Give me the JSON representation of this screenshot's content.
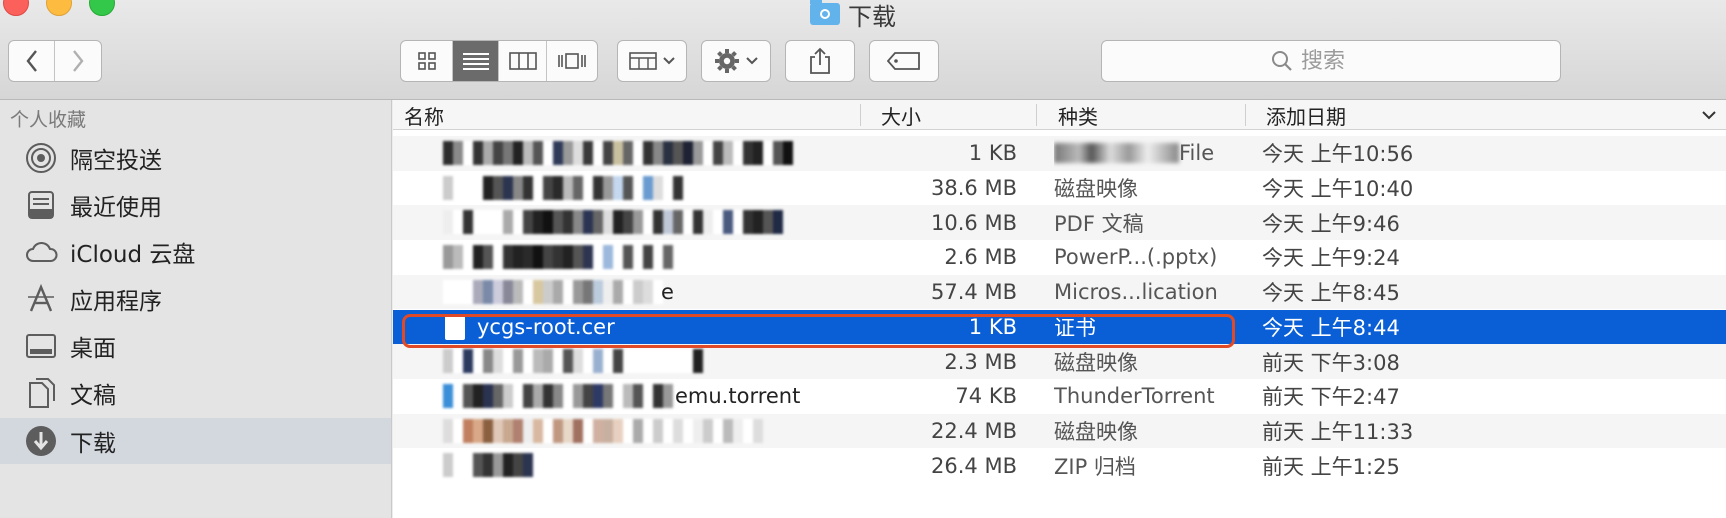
{
  "window": {
    "title": "下载"
  },
  "toolbar": {
    "back_icon": "chevron-left-icon",
    "forward_icon": "chevron-right-icon",
    "views": [
      "icon-view",
      "list-view",
      "column-view",
      "cover-flow-view"
    ],
    "active_view": "list-view",
    "search_placeholder": "搜索"
  },
  "sidebar": {
    "header": "个人收藏",
    "items": [
      {
        "label": "隔空投送",
        "icon": "airdrop-icon"
      },
      {
        "label": "最近使用",
        "icon": "recents-icon"
      },
      {
        "label": "iCloud 云盘",
        "icon": "cloud-icon"
      },
      {
        "label": "应用程序",
        "icon": "applications-icon"
      },
      {
        "label": "桌面",
        "icon": "desktop-icon"
      },
      {
        "label": "文稿",
        "icon": "documents-icon"
      },
      {
        "label": "下载",
        "icon": "downloads-icon",
        "selected": true
      }
    ]
  },
  "columns": {
    "name": "名称",
    "size": "大小",
    "kind": "种类",
    "date": "添加日期"
  },
  "files": [
    {
      "name": "",
      "size": "1 KB",
      "kind": "File",
      "date": "今天 上午10:56"
    },
    {
      "name": "",
      "size": "38.6 MB",
      "kind": "磁盘映像",
      "date": "今天 上午10:40"
    },
    {
      "name": "",
      "size": "10.6 MB",
      "kind": "PDF 文稿",
      "date": "今天 上午9:46"
    },
    {
      "name": "",
      "size": "2.6 MB",
      "kind": "PowerP...(.pptx)",
      "date": "今天 上午9:24"
    },
    {
      "name": "e",
      "size": "57.4 MB",
      "kind": "Micros...lication",
      "date": "今天 上午8:45"
    },
    {
      "name": "ycgs-root.cer",
      "size": "1 KB",
      "kind": "证书",
      "date": "今天 上午8:44",
      "selected": true
    },
    {
      "name": "",
      "size": "2.3 MB",
      "kind": "磁盘映像",
      "date": "前天 下午3:08"
    },
    {
      "name": "emu.torrent",
      "size": "74 KB",
      "kind": "ThunderTorrent",
      "date": "前天 下午2:47"
    },
    {
      "name": "",
      "size": "22.4 MB",
      "kind": "磁盘映像",
      "date": "前天 上午11:33"
    },
    {
      "name": "",
      "size": "26.4 MB",
      "kind": "ZIP 归档",
      "date": "前天 上午1:25"
    }
  ],
  "colors": {
    "selection": "#0a5fd6",
    "highlight_outline": "#e04a26"
  }
}
